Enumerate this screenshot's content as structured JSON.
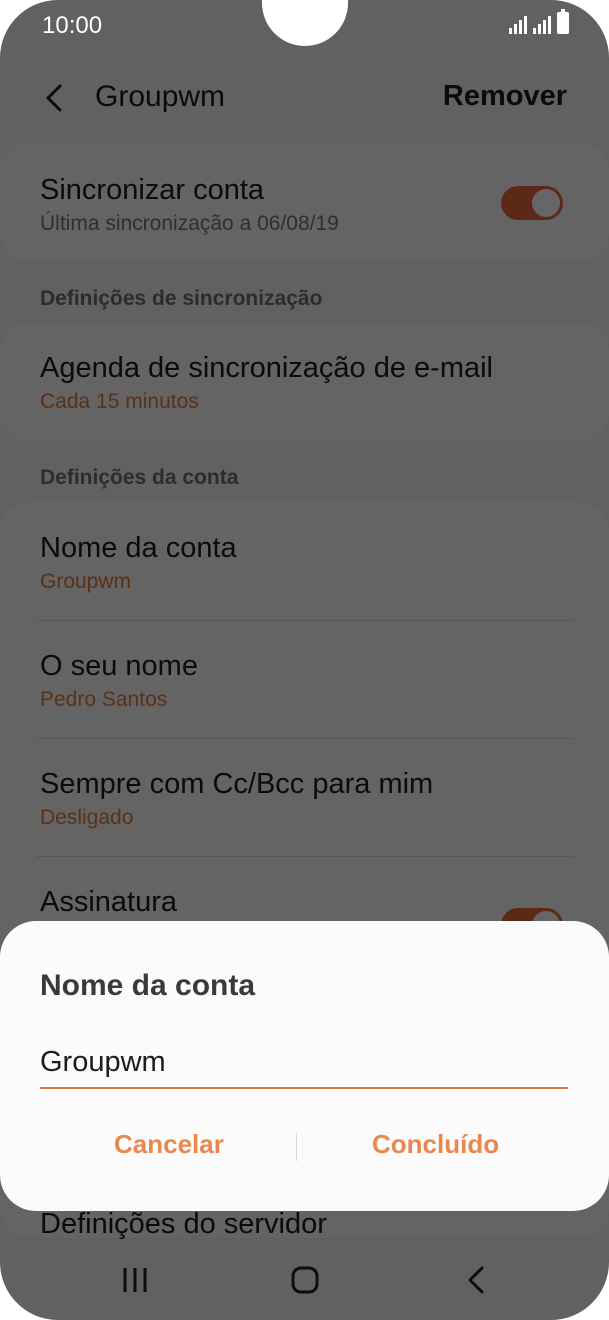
{
  "status_bar": {
    "time": "10:00"
  },
  "header": {
    "title": "Groupwm",
    "remove_label": "Remover"
  },
  "sync": {
    "title": "Sincronizar conta",
    "subtitle": "Última sincronização a 06/08/19",
    "toggle_on": true
  },
  "sections": {
    "sync_settings": "Definições de sincronização",
    "account_settings": "Definições da conta"
  },
  "email_schedule": {
    "title": "Agenda de sincronização de e-mail",
    "value": "Cada 15 minutos"
  },
  "account_items": [
    {
      "title": "Nome da conta",
      "value": "Groupwm"
    },
    {
      "title": "O seu nome",
      "value": "Pedro Santos"
    },
    {
      "title": "Sempre com Cc/Bcc para mim",
      "value": "Desligado"
    },
    {
      "title": "Assinatura",
      "toggle_on": true
    }
  ],
  "server_settings": {
    "title": "Definições do servidor"
  },
  "dialog": {
    "title": "Nome da conta",
    "input_value": "Groupwm",
    "cancel_label": "Cancelar",
    "done_label": "Concluído"
  },
  "colors": {
    "accent": "#e07a3e",
    "toggle": "#e8663a",
    "dialog_button": "#e8884f"
  },
  "icons": {
    "back": "chevron-left-icon",
    "nav_recents": "recent-apps-icon",
    "nav_home": "home-icon",
    "nav_back": "back-icon"
  }
}
